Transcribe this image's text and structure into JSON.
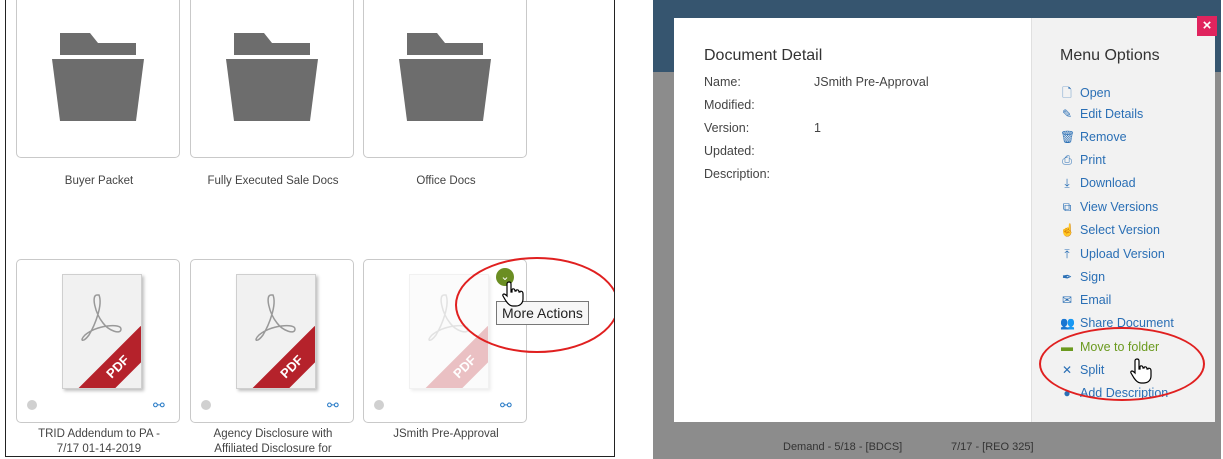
{
  "left": {
    "folders": [
      {
        "label": "Buyer Packet"
      },
      {
        "label": "Fully Executed Sale Docs"
      },
      {
        "label": "Office Docs"
      }
    ],
    "documents": [
      {
        "label_line1": "TRID Addendum to PA -",
        "label_line2": "7/17 01-14-2019",
        "badge": "PDF"
      },
      {
        "label_line1": "Agency Disclosure with",
        "label_line2": "Affiliated Disclosure for",
        "badge": "PDF"
      },
      {
        "label_line1": "JSmith Pre-Approval",
        "label_line2": "",
        "badge": "PDF"
      }
    ],
    "more_actions_tooltip": "More Actions"
  },
  "right": {
    "background_row_text": [
      "Demand - 5/18 - [BDCS]",
      "7/17 - [REO 325]"
    ],
    "detail": {
      "title": "Document Detail",
      "fields": [
        {
          "label": "Name:",
          "value": "JSmith Pre-Approval"
        },
        {
          "label": "Modified:",
          "value": ""
        },
        {
          "label": "Version:",
          "value": "1"
        },
        {
          "label": "Updated:",
          "value": ""
        },
        {
          "label": "Description:",
          "value": ""
        }
      ]
    },
    "menu": {
      "title": "Menu Options",
      "close_label": "×",
      "items": [
        {
          "label": "Open",
          "icon": "open-file-icon",
          "glyph": "🗋"
        },
        {
          "label": "Edit Details",
          "icon": "edit-icon",
          "glyph": "✎"
        },
        {
          "label": "Remove",
          "icon": "trash-icon",
          "glyph": "🗑"
        },
        {
          "label": "Print",
          "icon": "print-icon",
          "glyph": "⎙"
        },
        {
          "label": "Download",
          "icon": "download-icon",
          "glyph": "⤓"
        },
        {
          "label": "View Versions",
          "icon": "versions-icon",
          "glyph": "⧉"
        },
        {
          "label": "Select Version",
          "icon": "pointer-icon",
          "glyph": "☝"
        },
        {
          "label": "Upload Version",
          "icon": "upload-icon",
          "glyph": "⤒"
        },
        {
          "label": "Sign",
          "icon": "pen-icon",
          "glyph": "✒"
        },
        {
          "label": "Email",
          "icon": "email-icon",
          "glyph": "✉"
        },
        {
          "label": "Share Document",
          "icon": "share-icon",
          "glyph": "👥"
        },
        {
          "label": "Move to folder",
          "icon": "folder-icon",
          "glyph": "▬"
        },
        {
          "label": "Split",
          "icon": "split-icon",
          "glyph": "✕"
        },
        {
          "label": "Add Description",
          "icon": "circle-icon",
          "glyph": "●"
        }
      ]
    }
  },
  "colors": {
    "accent_green": "#6b8e23",
    "annotation_red": "#e02020",
    "link_blue": "#2a6fb5",
    "pdf_red": "#b5222b"
  }
}
